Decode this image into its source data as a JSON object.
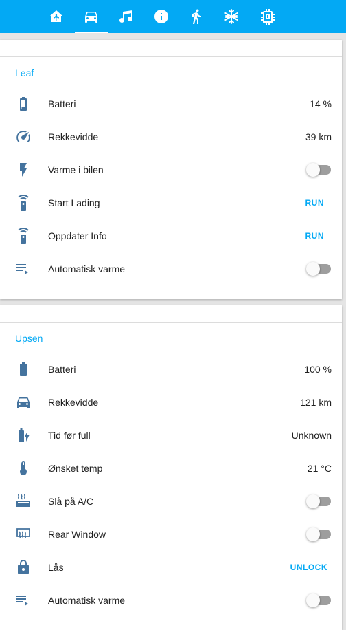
{
  "colors": {
    "accent": "#03a9f4",
    "icon": "#44739e",
    "toggle_off": "#9e9e9e"
  },
  "tabs": [
    {
      "icon": "home-assistant-icon"
    },
    {
      "icon": "car-icon",
      "active": true
    },
    {
      "icon": "music-note-icon"
    },
    {
      "icon": "info-icon"
    },
    {
      "icon": "running-person-icon"
    },
    {
      "icon": "snowflake-icon"
    },
    {
      "icon": "chip-icon"
    }
  ],
  "leaf": {
    "title": "Leaf",
    "rows": [
      {
        "icon": "battery-icon",
        "label": "Batteri",
        "value": "14 %"
      },
      {
        "icon": "speedometer-icon",
        "label": "Rekkevidde",
        "value": "39 km"
      },
      {
        "icon": "flash-icon",
        "label": "Varme i bilen",
        "toggle": false
      },
      {
        "icon": "remote-icon",
        "label": "Start Lading",
        "action": "RUN"
      },
      {
        "icon": "remote-icon",
        "label": "Oppdater Info",
        "action": "RUN"
      },
      {
        "icon": "playlist-play-icon",
        "label": "Automatisk varme",
        "toggle": false
      }
    ]
  },
  "upsen": {
    "title": "Upsen",
    "rows": [
      {
        "icon": "battery-full-icon",
        "label": "Batteri",
        "value": "100 %"
      },
      {
        "icon": "car-icon",
        "label": "Rekkevidde",
        "value": "121 km"
      },
      {
        "icon": "battery-charging-icon",
        "label": "Tid før full",
        "value": "Unknown"
      },
      {
        "icon": "thermometer-icon",
        "label": "Ønsket temp",
        "value": "21 °C"
      },
      {
        "icon": "air-conditioner-icon",
        "label": "Slå på A/C",
        "toggle": false
      },
      {
        "icon": "rear-defrost-icon",
        "label": "Rear Window",
        "toggle": false
      },
      {
        "icon": "lock-icon",
        "label": "Lås",
        "action": "UNLOCK"
      },
      {
        "icon": "playlist-play-icon",
        "label": "Automatisk varme",
        "toggle": false
      }
    ]
  }
}
